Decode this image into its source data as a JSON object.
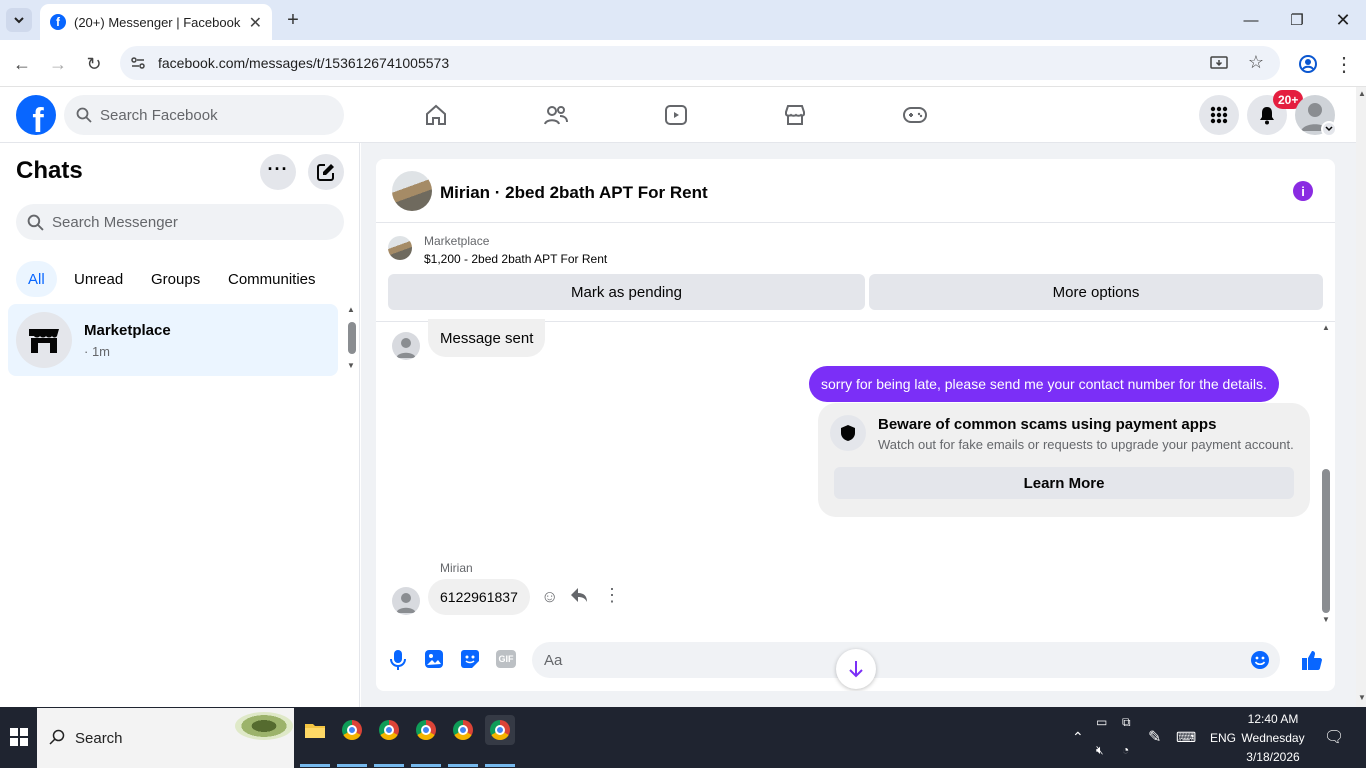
{
  "browser": {
    "tab_title": "(20+) Messenger | Facebook",
    "url": "facebook.com/messages/t/1536126741005573"
  },
  "fb_header": {
    "search_placeholder": "Search Facebook",
    "notifications_badge": "20+",
    "accent": "#0866ff"
  },
  "sidebar": {
    "title": "Chats",
    "search_placeholder": "Search Messenger",
    "filters": [
      "All",
      "Unread",
      "Groups",
      "Communities"
    ],
    "active_filter": "All",
    "conversations": [
      {
        "name": "Marketplace",
        "meta": "· 1m"
      }
    ]
  },
  "chat": {
    "title": "Mirian · 2bed 2bath APT For Rent",
    "marketplace_label": "Marketplace",
    "listing": "$1,200 - 2bed 2bath APT For Rent",
    "mark_pending_label": "Mark as pending",
    "more_options_label": "More options",
    "messages": {
      "incoming_first": "Message sent",
      "outgoing": "sorry for being late, please send me your contact number for the details.",
      "scam_title": "Beware of common scams using payment apps",
      "scam_body": "Watch out for fake emails or requests to upgrade your payment account.",
      "learn_more": "Learn More",
      "sender_name": "Mirian",
      "incoming_number": "6122961837"
    },
    "composer_placeholder": "Aa",
    "outgoing_color": "#7b2ff7",
    "info_color": "#8a2be2"
  },
  "taskbar": {
    "search_label": "Search",
    "lang": "ENG",
    "time": "12:40 AM",
    "day": "Wednesday",
    "date": "3/18/2026"
  }
}
